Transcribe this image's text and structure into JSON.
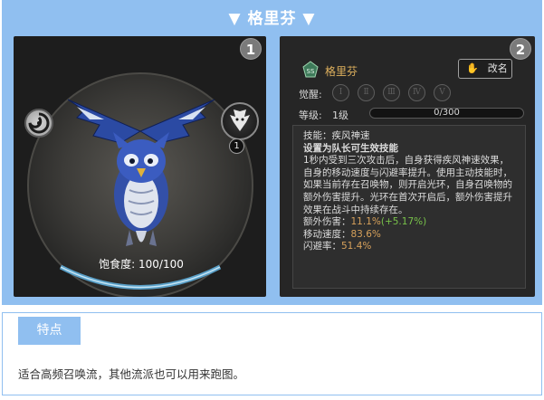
{
  "header": {
    "title": "▼ 格里芬 ▼"
  },
  "screenshot_left": {
    "badge": "1",
    "level_badge": "1",
    "satiety_label": "饱食度:",
    "satiety_value": "100/100",
    "satiety_fraction": 1.0
  },
  "screenshot_right": {
    "badge": "2",
    "pet_name": "格里芬",
    "rename_label": "改名",
    "awaken_label": "觉醒:",
    "awaken_levels": [
      "Ⅰ",
      "Ⅱ",
      "Ⅲ",
      "Ⅳ",
      "Ⅴ"
    ],
    "level_label": "等级:",
    "level_value": "1级",
    "xp_text": "0/300",
    "skill_label": "技能：",
    "skill_name": "疾风神速",
    "skill_condition": "设置为队长可生效技能",
    "skill_desc_1": "1秒内受到三次攻击后，自身获得疾风神速效果，自身的移动速度与闪避率提升。使用主动技能时，如果当前存在召唤物，则开启光环，自身召唤物的额外伤害提升。光环在首次开启后，额外伤害提升效果在战斗中持续存在。",
    "stats": [
      {
        "label": "额外伤害：",
        "value": "11.1%",
        "bonus": "(+5.17%)"
      },
      {
        "label": "移动速度：",
        "value": "83.6%",
        "bonus": ""
      },
      {
        "label": "闪避率：",
        "value": "51.4%",
        "bonus": ""
      }
    ]
  },
  "features": {
    "tab_label": "特点",
    "text": "适合高频召唤流，其他流派也可以用来跑图。"
  },
  "colors": {
    "accent_blue": "#90bff0",
    "gold_name": "#e0b25e",
    "stat_value": "#d7a15b",
    "stat_bonus": "#78c24a"
  }
}
